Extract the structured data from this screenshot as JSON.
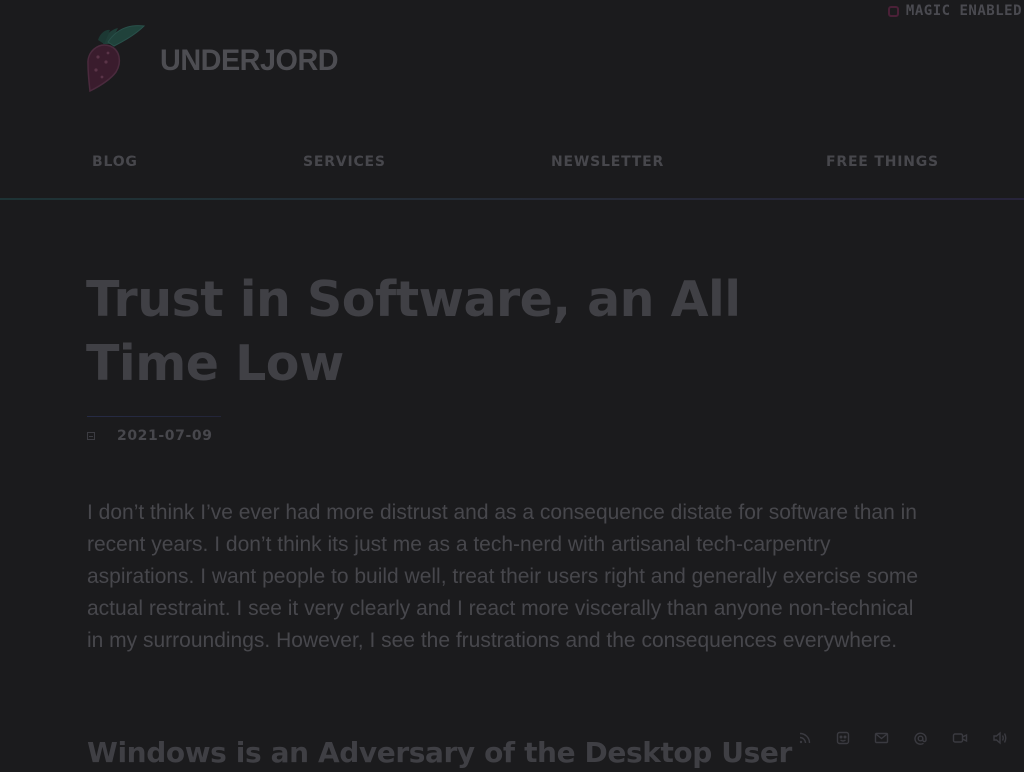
{
  "magic_toggle": {
    "label": "MAGIC ENABLED",
    "checked": false
  },
  "logo": {
    "text": "UNDERJORD",
    "icon": "beet-icon"
  },
  "nav": {
    "items": [
      {
        "label": "BLOG"
      },
      {
        "label": "SERVICES"
      },
      {
        "label": "NEWSLETTER"
      },
      {
        "label": "FREE THINGS"
      }
    ]
  },
  "article": {
    "title": "Trust in Software, an All Time Low",
    "date": "2021-07-09",
    "date_icon": "calendar-icon",
    "intro": "I don’t think I’ve ever had more distrust and as a consequence distate for software than in recent years. I don’t think its just me as a tech-nerd with artisanal tech-carpentry aspirations. I want people to build well, treat their users right and generally exercise some actual restraint. I see it very clearly and I react more viscerally than anyone non-technical in my surroundings. However, I see the frustrations and the consequences everywhere.",
    "section_heading": "Windows is an Adversary of the Desktop User"
  },
  "social_icons": [
    "rss-icon",
    "face-icon",
    "mail-icon",
    "at-icon",
    "video-icon",
    "speaker-icon"
  ],
  "colors": {
    "background": "#1b1b1d",
    "text_dim": "#47474c",
    "accent_magenta": "#4a2037",
    "accent_teal": "#1e3335"
  }
}
